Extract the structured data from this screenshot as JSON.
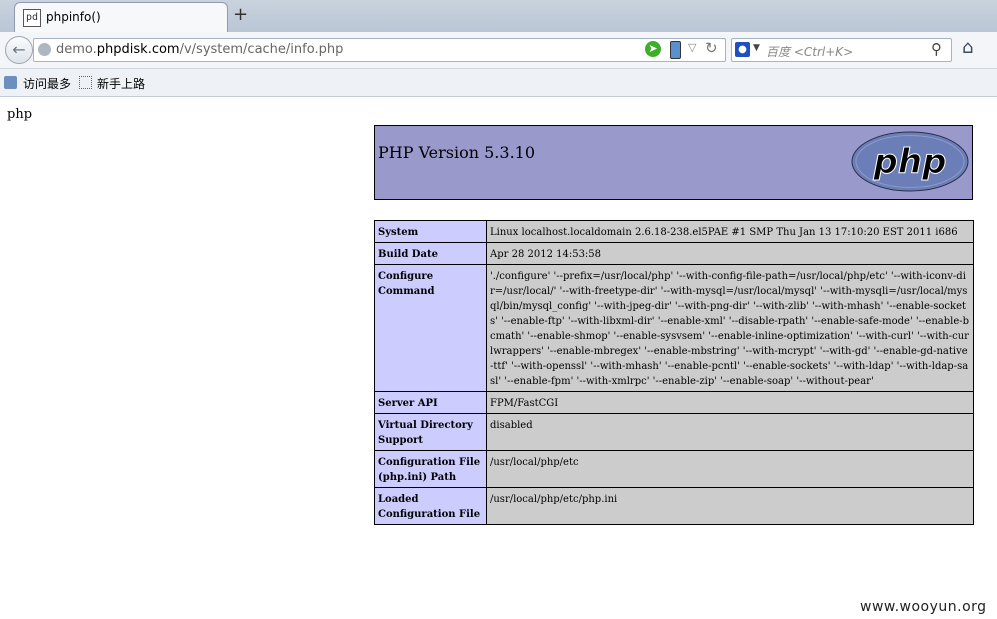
{
  "browser": {
    "tab_title": "phpinfo()",
    "url_domain": "demo.",
    "url_host": "phpdisk.com",
    "url_path": "/v/system/cache/info.php",
    "search_placeholder": "百度 <Ctrl+K>",
    "bookmarks": [
      "访问最多",
      "新手上路"
    ]
  },
  "page": {
    "heading_text": "php",
    "version": "PHP Version 5.3.10",
    "logo_text": "php",
    "rows": [
      {
        "key": "System",
        "value": "Linux localhost.localdomain 2.6.18-238.el5PAE #1 SMP Thu Jan 13 17:10:20 EST 2011 i686"
      },
      {
        "key": "Build Date",
        "value": "Apr 28 2012 14:53:58"
      },
      {
        "key": "Configure Command",
        "value": "'./configure' '--prefix=/usr/local/php' '--with-config-file-path=/usr/local/php/etc' '--with-iconv-dir=/usr/local/' '--with-freetype-dir' '--with-mysql=/usr/local/mysql' '--with-mysqli=/usr/local/mysql/bin/mysql_config' '--with-jpeg-dir' '--with-png-dir' '--with-zlib' '--with-mhash' '--enable-sockets' '--enable-ftp' '--with-libxml-dir' '--enable-xml' '--disable-rpath' '--enable-safe-mode' '--enable-bcmath' '--enable-shmop' '--enable-sysvsem' '--enable-inline-optimization' '--with-curl' '--with-curlwrappers' '--enable-mbregex' '--enable-mbstring' '--with-mcrypt' '--with-gd' '--enable-gd-native-ttf' '--with-openssl' '--with-mhash' '--enable-pcntl' '--enable-sockets' '--with-ldap' '--with-ldap-sasl' '--enable-fpm' '--with-xmlrpc' '--enable-zip' '--enable-soap' '--without-pear'"
      },
      {
        "key": "Server API",
        "value": "FPM/FastCGI"
      },
      {
        "key": "Virtual Directory Support",
        "value": "disabled"
      },
      {
        "key": "Configuration File (php.ini) Path",
        "value": "/usr/local/php/etc"
      },
      {
        "key": "Loaded Configuration File",
        "value": "/usr/local/php/etc/php.ini"
      }
    ]
  },
  "watermark": "www.wooyun.org"
}
